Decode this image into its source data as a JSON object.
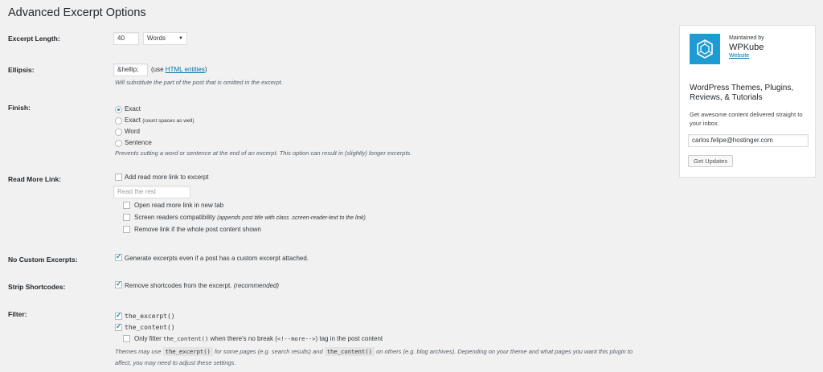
{
  "page_title": "Advanced Excerpt Options",
  "excerpt_length": {
    "label": "Excerpt Length:",
    "value": "40",
    "unit": "Words"
  },
  "ellipsis": {
    "label": "Ellipsis:",
    "value": "&hellip;",
    "use_prefix": "(use",
    "use_link": "HTML entities",
    "use_suffix": ")",
    "description": "Will substitute the part of the post that is omitted in the excerpt."
  },
  "finish": {
    "label": "Finish:",
    "options": [
      {
        "label": "Exact",
        "note": "",
        "checked": true
      },
      {
        "label": "Exact",
        "note": "(count spaces as well)",
        "checked": false
      },
      {
        "label": "Word",
        "note": "",
        "checked": false
      },
      {
        "label": "Sentence",
        "note": "",
        "checked": false
      }
    ],
    "description": "Prevents cutting a word or sentence at the end of an excerpt. This option can result in (slightly) longer excerpts."
  },
  "read_more": {
    "label": "Read More Link:",
    "add_label": "Add read more link to excerpt",
    "text_placeholder": "Read the rest",
    "sub_options": [
      {
        "label": "Open read more link in new tab",
        "note": ""
      },
      {
        "label": "Screen readers compatibility",
        "note": "(appends post title with class .screen-reader-text to the link)"
      },
      {
        "label": "Remove link if the whole post content shown",
        "note": ""
      }
    ]
  },
  "no_custom": {
    "label": "No Custom Excerpts:",
    "option": "Generate excerpts even if a post has a custom excerpt attached."
  },
  "strip_shortcodes": {
    "label": "Strip Shortcodes:",
    "option": "Remove shortcodes from the excerpt.",
    "note": "(recommended)"
  },
  "filter": {
    "label": "Filter:",
    "opt1": "the_excerpt()",
    "opt2": "the_content()",
    "opt3_pre": "Only filter",
    "opt3_code": "the_content()",
    "opt3_mid": "when there's no break (",
    "opt3_code2": "<!--more-->",
    "opt3_post": ") tag in the post content",
    "desc_1": "Themes may use",
    "desc_code1": "the_excerpt()",
    "desc_2": "for some pages (e.g. search results) and",
    "desc_code2": "the_content()",
    "desc_3": "on others (e.g. blog archives). Depending on your theme and what pages you want this plugin to",
    "desc_4": "affect, you may need to adjust these settings."
  },
  "sidebar": {
    "maintained_by": "Maintained by",
    "brand": "WPKube",
    "website": "Website",
    "heading": "WordPress Themes, Plugins, Reviews, & Tutorials",
    "blurb": "Get awesome content delivered straight to your inbox.",
    "email": "carlos.felipe@hostinger.com",
    "button": "Get Updates",
    "logo_color": "#1f9bd4"
  }
}
